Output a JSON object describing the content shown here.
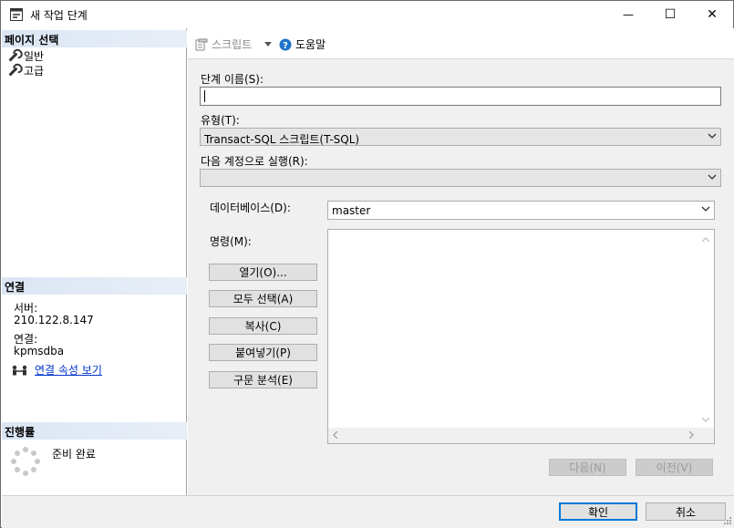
{
  "window": {
    "title": "새 작업 단계",
    "minimize_glyph": "—",
    "maximize_glyph": "☐",
    "close_glyph": "✕"
  },
  "left": {
    "page_select_header": "페이지 선택",
    "pages": [
      "일반",
      "고급"
    ],
    "connection_header": "연결",
    "server_label": "서버:",
    "server_value": "210.122.8.147",
    "connection_label": "연결:",
    "connection_value": "kpmsdba",
    "view_connection_props": "연결 속성 보기",
    "progress_header": "진행률",
    "progress_status": "준비 완료"
  },
  "toolbar": {
    "script_label": "스크립트",
    "help_label": "도움말",
    "icons": [
      "script-icon",
      "dropdown-arrow-icon",
      "help-icon"
    ]
  },
  "form": {
    "step_name_label": "단계 이름(S):",
    "step_name_value": "",
    "type_label": "유형(T):",
    "type_value": "Transact-SQL 스크립트(T-SQL)",
    "run_as_label": "다음 계정으로 실행(R):",
    "run_as_value": "",
    "database_label": "데이터베이스(D):",
    "database_value": "master",
    "command_label": "명령(M):",
    "command_value": "",
    "buttons": {
      "open": "열기(O)...",
      "select_all": "모두 선택(A)",
      "copy": "복사(C)",
      "paste": "붙여넣기(P)",
      "parse": "구문 분석(E)"
    },
    "next": "다음(N)",
    "previous": "이전(V)"
  },
  "footer": {
    "ok": "확인",
    "cancel": "취소"
  },
  "colors": {
    "accent": "#0078d7",
    "link": "#0033cc",
    "panel_bg": "#f0f0f0",
    "section_header": "#dbe6f4"
  }
}
